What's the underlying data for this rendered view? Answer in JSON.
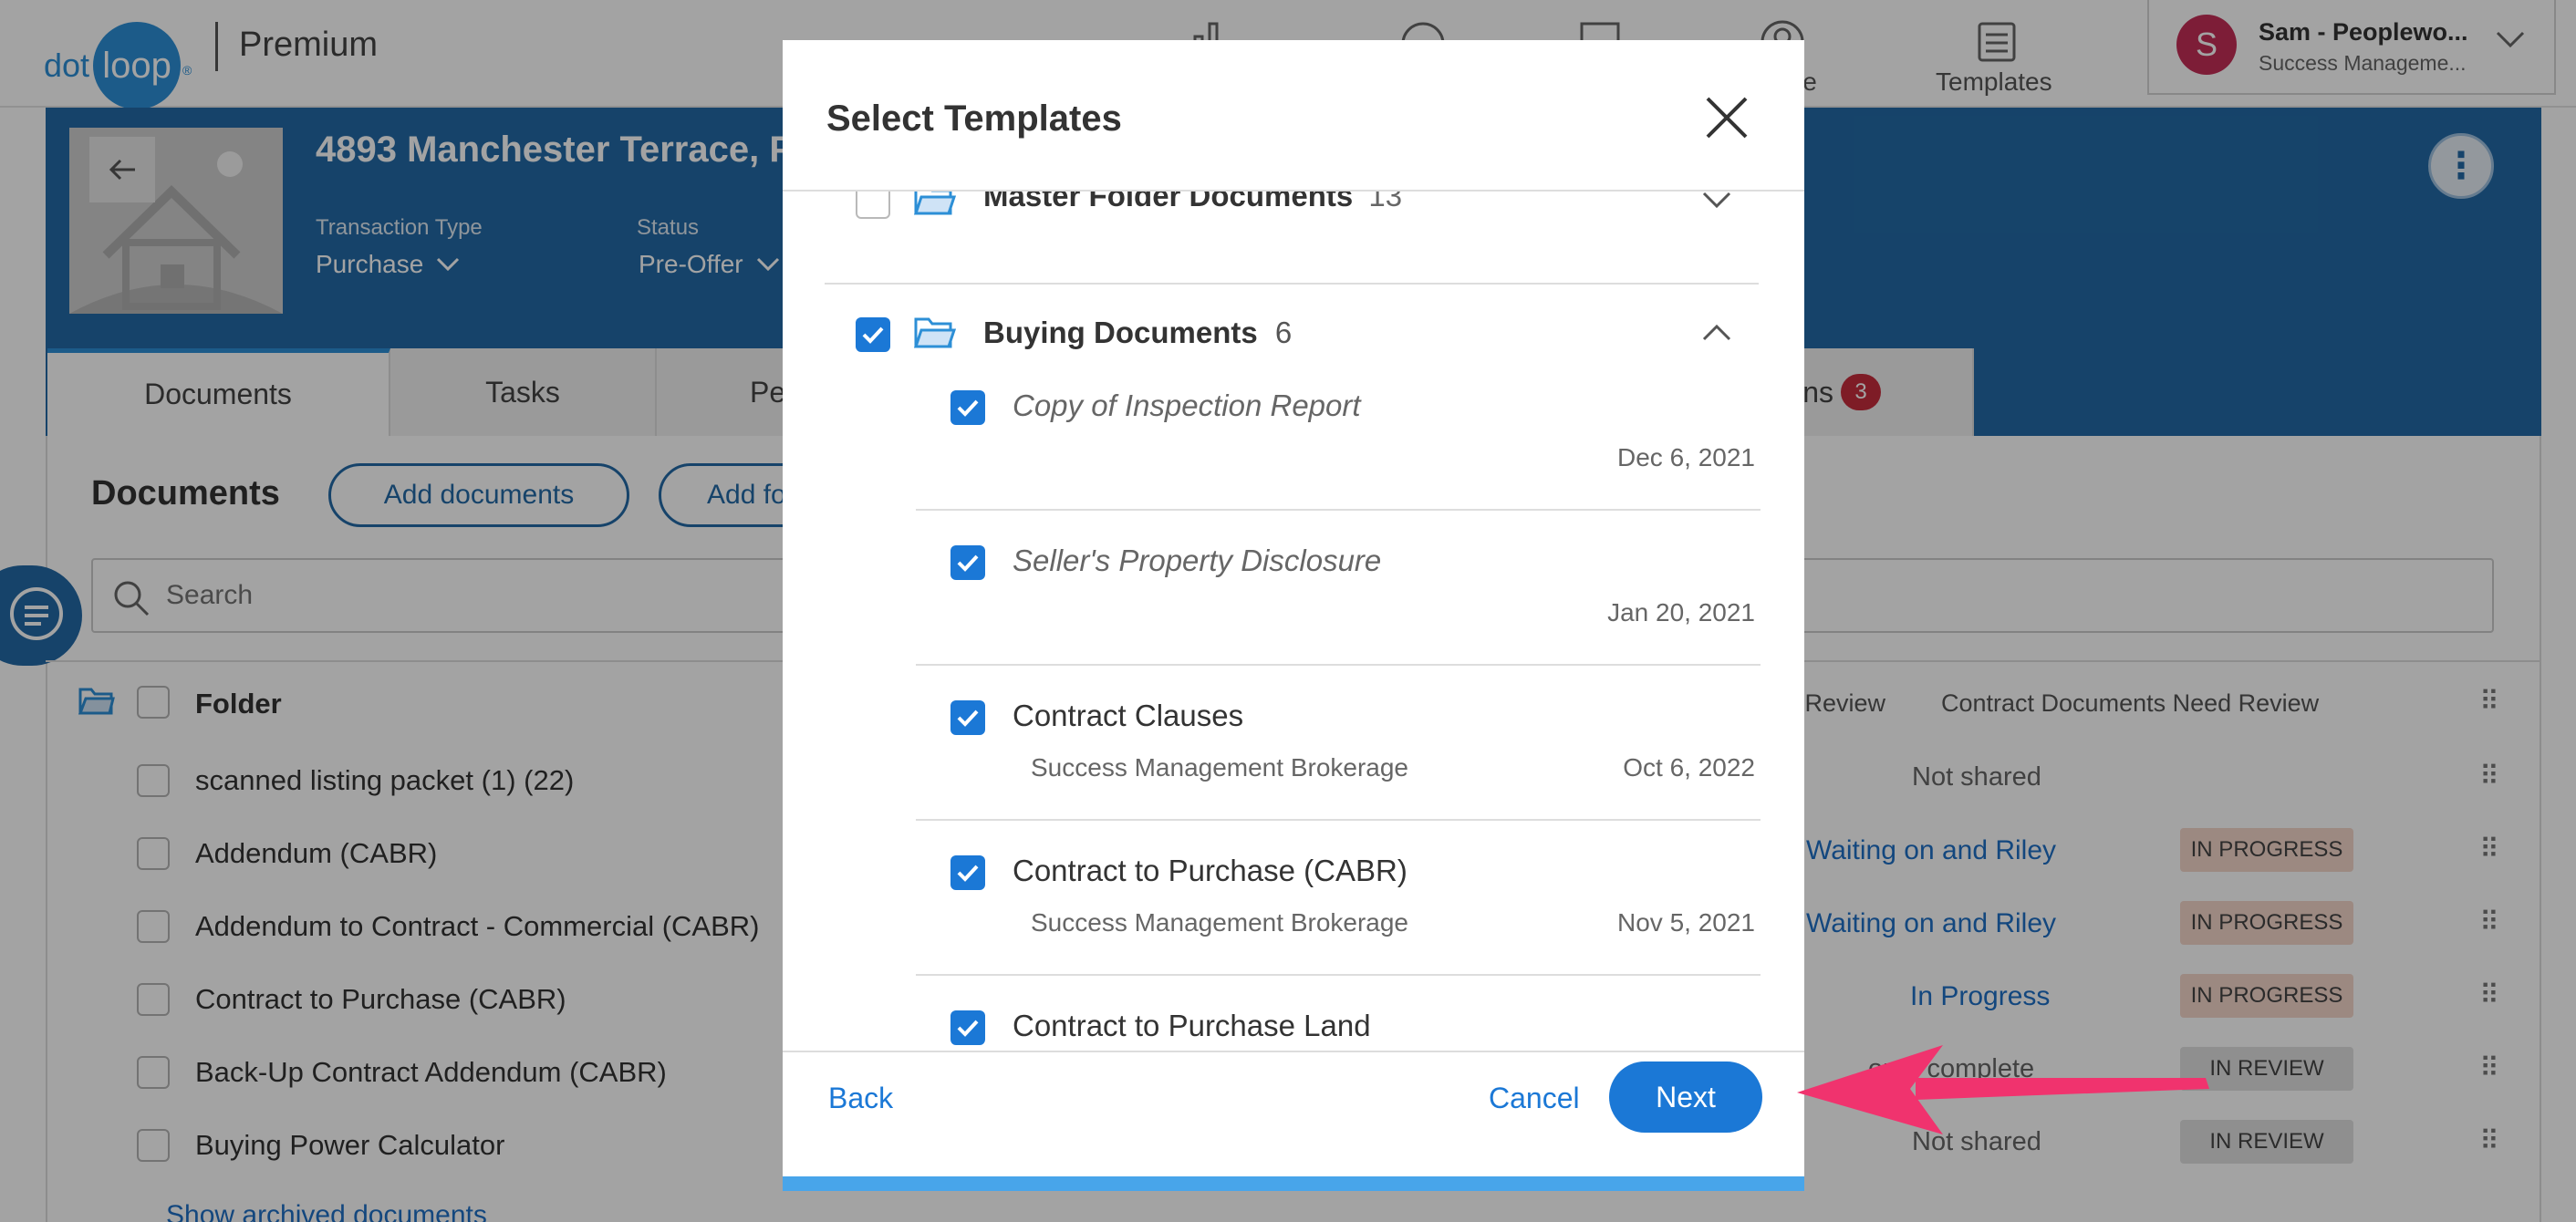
{
  "app": {
    "logo_dot": "dot",
    "logo_loop": "loop",
    "logo_reg": "®",
    "plan": "Premium",
    "nav_items": [
      {
        "icon": "chart-icon",
        "label": ""
      },
      {
        "icon": "circle-icon",
        "label": ""
      },
      {
        "icon": "check-square-icon",
        "label": ""
      },
      {
        "icon": "people-icon",
        "label": "le"
      },
      {
        "icon": "templates-icon",
        "label": "Templates"
      }
    ],
    "user": {
      "initial": "S",
      "name": "Sam - Peoplewo...",
      "org": "Success Manageme..."
    }
  },
  "loop": {
    "title": "4893 Manchester Terrace, P",
    "transaction_type_label": "Transaction Type",
    "transaction_type_value": "Purchase",
    "status_label": "Status",
    "status_value": "Pre-Offer"
  },
  "tabs": [
    {
      "label": "Documents",
      "active": true
    },
    {
      "label": "Tasks",
      "active": false
    },
    {
      "label": "Pe",
      "active": false
    },
    {
      "label": "ns",
      "active": false,
      "badge": "3"
    }
  ],
  "documents": {
    "heading": "Documents",
    "add_documents": "Add documents",
    "add_folder": "Add fo",
    "search_placeholder": "Search",
    "folder_col": "Folder",
    "col_review": "ct Review",
    "col_contract_review": "Contract Documents Need Review",
    "rows": [
      {
        "name": "scanned listing packet (1) (22)",
        "share": "Not shared",
        "share_link": false,
        "status": ""
      },
      {
        "name": "Addendum (CABR)",
        "share": "Waiting on and Riley",
        "share_link": true,
        "status": "IN PROGRESS"
      },
      {
        "name": "Addendum to Contract - Commercial (CABR)",
        "share": "Waiting on and Riley",
        "share_link": true,
        "status": "IN PROGRESS"
      },
      {
        "name": "Contract to Purchase (CABR)",
        "share": "In Progress",
        "share_link": true,
        "status": "IN PROGRESS"
      },
      {
        "name": "Back-Up Contract Addendum (CABR)",
        "share": "oute complete",
        "share_link": false,
        "status": "IN REVIEW"
      },
      {
        "name": "Buying Power Calculator",
        "share": "Not shared",
        "share_link": false,
        "status": "IN REVIEW"
      }
    ],
    "show_archived": "Show archived documents"
  },
  "modal": {
    "title": "Select Templates",
    "master_folder": {
      "name": "Master Folder Documents",
      "count": "13"
    },
    "buying_folder": {
      "name": "Buying Documents",
      "count": "6"
    },
    "templates": [
      {
        "name": "Copy of Inspection Report",
        "italic": true,
        "sub": "",
        "date": "Dec 6, 2021"
      },
      {
        "name": "Seller's Property Disclosure",
        "italic": true,
        "sub": "",
        "date": "Jan 20, 2021"
      },
      {
        "name": "Contract Clauses",
        "italic": false,
        "sub": "Success Management Brokerage",
        "date": "Oct 6, 2022"
      },
      {
        "name": "Contract to Purchase (CABR)",
        "italic": false,
        "sub": "Success Management Brokerage",
        "date": "Nov 5, 2021"
      },
      {
        "name": "Contract to Purchase Land",
        "italic": false,
        "sub": "",
        "date": ""
      }
    ],
    "back": "Back",
    "cancel": "Cancel",
    "next": "Next"
  },
  "colors": {
    "brand": "#236aa6",
    "accent": "#1b78d6",
    "annotation_arrow": "#f0336e"
  }
}
